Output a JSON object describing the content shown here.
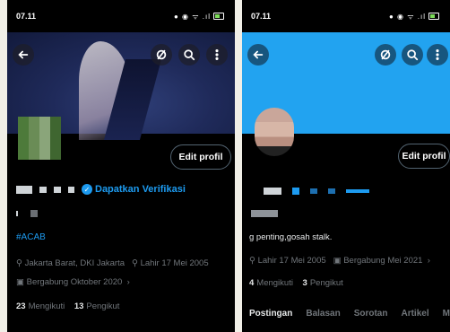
{
  "left": {
    "status_time": "07.11",
    "verify_label": "Dapatkan Verifikasi",
    "edit_label": "Edit profil",
    "hashtag": "#ACAB",
    "location": "Jakarta Barat, DKI Jakarta",
    "birth": "Lahir 17 Mei 2005",
    "joined": "Bergabung Oktober 2020",
    "following_count": "23",
    "following_label": "Mengikuti",
    "followers_count": "13",
    "followers_label": "Pengikut"
  },
  "right": {
    "status_time": "07.11",
    "edit_label": "Edit profil",
    "bio": "g penting,gosah stalk.",
    "birth": "Lahir 17 Mei 2005",
    "joined": "Bergabung Mei 2021",
    "following_count": "4",
    "following_label": "Mengikuti",
    "followers_count": "3",
    "followers_label": "Pengikut",
    "tabs": [
      "Postingan",
      "Balasan",
      "Sorotan",
      "Artikel",
      "Me"
    ]
  },
  "colors": {
    "accent": "#1d9bf0",
    "banner_right": "#22a3f0"
  }
}
